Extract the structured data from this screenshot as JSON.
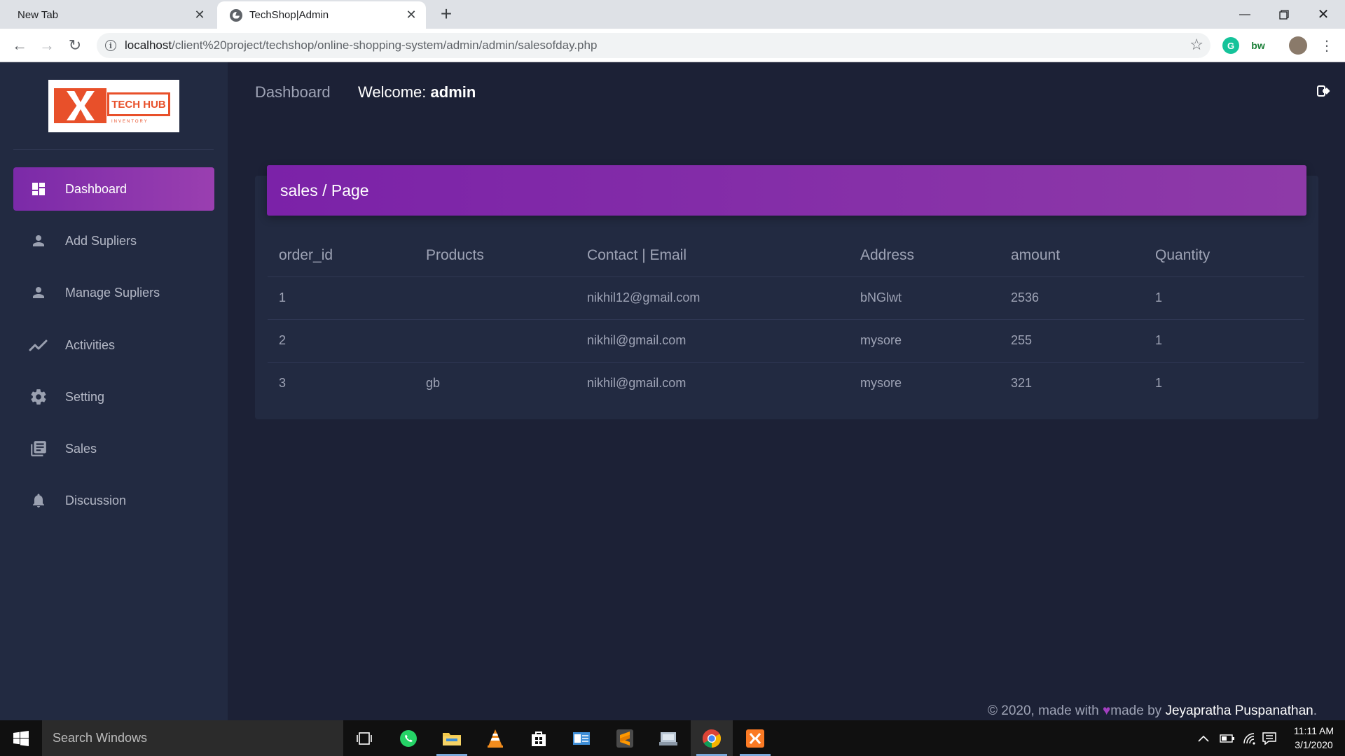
{
  "browser": {
    "tabs": [
      {
        "title": "New Tab",
        "active": false
      },
      {
        "title": "TechShop|Admin",
        "active": true
      }
    ],
    "url_host": "localhost",
    "url_path": "/client%20project/techshop/online-shopping-system/admin/admin/salesofday.php",
    "icons": [
      "back-icon",
      "forward-icon",
      "reload-icon",
      "info-icon",
      "star-icon",
      "grammarly-icon",
      "bw-extension-icon",
      "profile-avatar",
      "more-icon"
    ],
    "extension_label": "bw"
  },
  "sidebar": {
    "logo": {
      "brand": "TECH HUB",
      "sub": "INVENTORY"
    },
    "items": [
      {
        "label": "Dashboard",
        "icon": "dashboard-icon",
        "active": true
      },
      {
        "label": "Add Supliers",
        "icon": "person-icon",
        "active": false
      },
      {
        "label": "Manage Supliers",
        "icon": "person-icon",
        "active": false
      },
      {
        "label": "Activities",
        "icon": "trending-icon",
        "active": false
      },
      {
        "label": "Setting",
        "icon": "gear-icon",
        "active": false
      },
      {
        "label": "Sales",
        "icon": "library-books-icon",
        "active": false
      },
      {
        "label": "Discussion",
        "icon": "bell-icon",
        "active": false
      }
    ]
  },
  "topnav": {
    "dashboard_label": "Dashboard",
    "welcome_prefix": "Welcome:",
    "username": "admin"
  },
  "card": {
    "title": "sales / Page",
    "columns": [
      "order_id",
      "Products",
      "Contact | Email",
      "Address",
      "amount",
      "Quantity"
    ],
    "rows": [
      [
        "1",
        "",
        "nikhil12@gmail.com",
        "bNGlwt",
        "2536",
        "1"
      ],
      [
        "2",
        "",
        "nikhil@gmail.com",
        "mysore",
        "255",
        "1"
      ],
      [
        "3",
        "gb",
        "nikhil@gmail.com",
        "mysore",
        "321",
        "1"
      ]
    ]
  },
  "footer": {
    "prefix": "© 2020, made with",
    "middle": "made by",
    "author": "Jeyapratha Puspanathan",
    "suffix": "."
  },
  "taskbar": {
    "search_placeholder": "Search Windows",
    "apps": [
      "task-view-icon",
      "whatsapp-icon",
      "file-explorer-icon",
      "vlc-icon",
      "store-icon",
      "outlook-icon",
      "sublime-icon",
      "network-drive-icon",
      "chrome-icon",
      "xampp-icon"
    ],
    "time": "11:11 AM",
    "date": "3/1/2020"
  },
  "colors": {
    "accent_purple": "#7b22a8",
    "sidebar_bg": "#222a41",
    "main_bg": "#1c2136"
  }
}
